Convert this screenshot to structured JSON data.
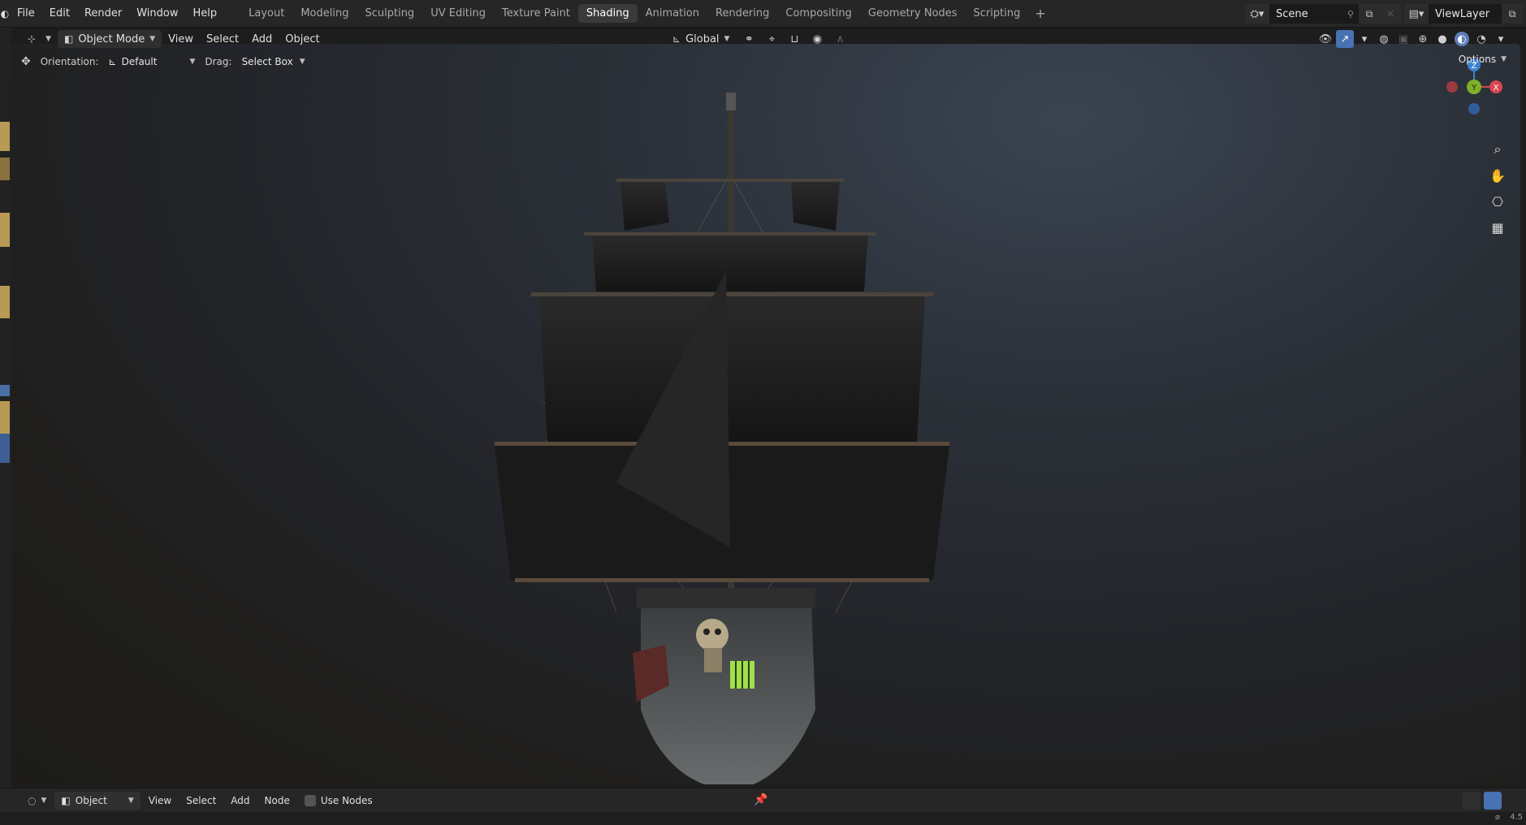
{
  "topbar": {
    "menu": [
      "File",
      "Edit",
      "Render",
      "Window",
      "Help"
    ],
    "workspaces": [
      "Layout",
      "Modeling",
      "Sculpting",
      "UV Editing",
      "Texture Paint",
      "Shading",
      "Animation",
      "Rendering",
      "Compositing",
      "Geometry Nodes",
      "Scripting"
    ],
    "active_workspace": "Shading",
    "add_workspace": "+",
    "scene_name": "Scene",
    "view_layer_name": "ViewLayer"
  },
  "viewport_header": {
    "mode": "Object Mode",
    "menus": [
      "View",
      "Select",
      "Add",
      "Object"
    ],
    "transform_orientation": "Global"
  },
  "tool_settings": {
    "orientation_label": "Orientation:",
    "orientation_value": "Default",
    "drag_label": "Drag:",
    "drag_value": "Select Box",
    "options_label": "Options"
  },
  "gizmo": {
    "z_label": "Z",
    "x_label": "X",
    "y_label": "Y",
    "colors": {
      "x": "#d9474f",
      "y": "#7fb02a",
      "z": "#3b82d1"
    }
  },
  "bottom_header": {
    "editor_type_value": "Object",
    "menus": [
      "View",
      "Select",
      "Add",
      "Node"
    ],
    "use_nodes_label": "Use Nodes"
  },
  "status": {
    "version_text": "4.5"
  }
}
